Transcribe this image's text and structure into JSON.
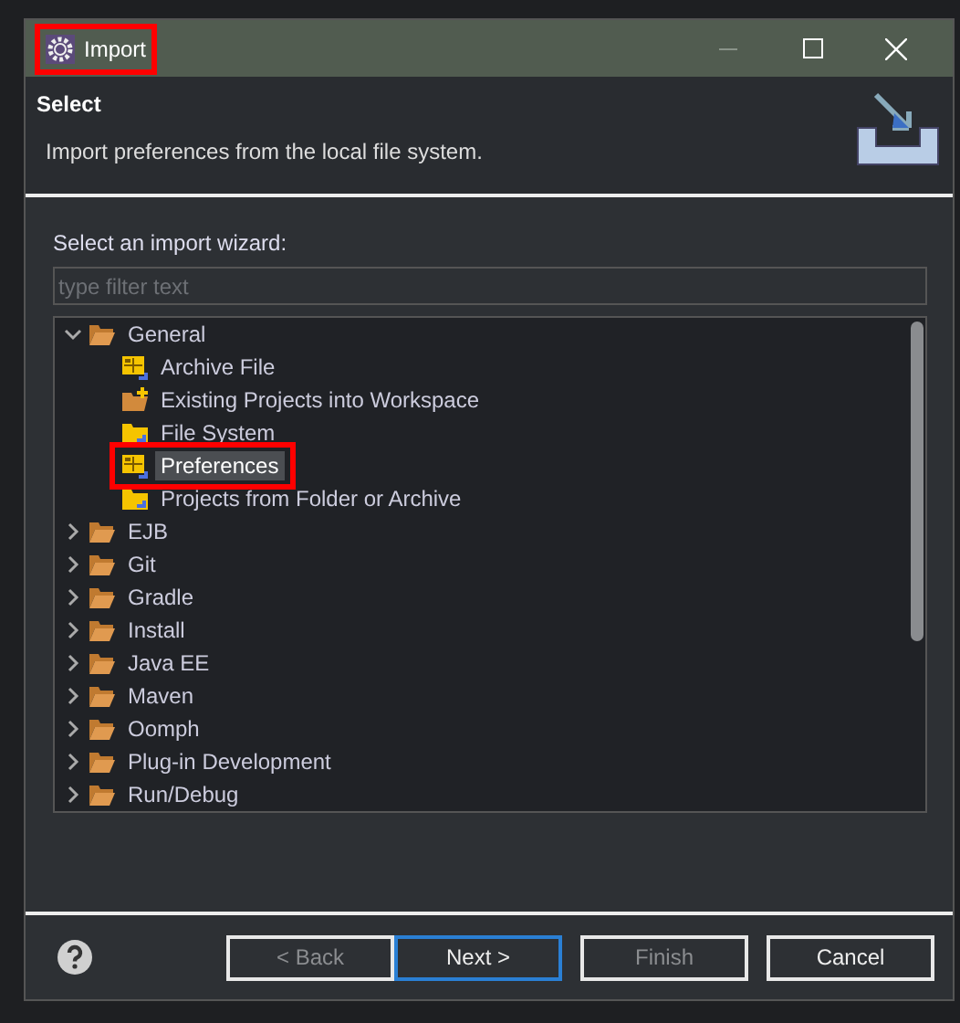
{
  "window": {
    "title": "Import",
    "highlighted": true
  },
  "header": {
    "title": "Select",
    "description": "Import preferences from the local file system."
  },
  "wizard": {
    "label": "Select an import wizard:",
    "filter": {
      "placeholder": "type filter text"
    },
    "tree": [
      {
        "label": "General",
        "expanded": true,
        "selected": false,
        "highlighted": false,
        "children": [
          {
            "label": "Archive File",
            "kind": "wizard",
            "selected": false,
            "highlighted": false
          },
          {
            "label": "Existing Projects into Workspace",
            "kind": "project",
            "selected": false,
            "highlighted": false
          },
          {
            "label": "File System",
            "kind": "folder",
            "selected": false,
            "highlighted": false
          },
          {
            "label": "Preferences",
            "kind": "wizard",
            "selected": true,
            "highlighted": true
          },
          {
            "label": "Projects from Folder or Archive",
            "kind": "folder",
            "selected": false,
            "highlighted": false
          }
        ]
      },
      {
        "label": "EJB",
        "expanded": false,
        "selected": false,
        "highlighted": false
      },
      {
        "label": "Git",
        "expanded": false,
        "selected": false,
        "highlighted": false
      },
      {
        "label": "Gradle",
        "expanded": false,
        "selected": false,
        "highlighted": false
      },
      {
        "label": "Install",
        "expanded": false,
        "selected": false,
        "highlighted": false
      },
      {
        "label": "Java EE",
        "expanded": false,
        "selected": false,
        "highlighted": false
      },
      {
        "label": "Maven",
        "expanded": false,
        "selected": false,
        "highlighted": false
      },
      {
        "label": "Oomph",
        "expanded": false,
        "selected": false,
        "highlighted": false
      },
      {
        "label": "Plug-in Development",
        "expanded": false,
        "selected": false,
        "highlighted": false
      },
      {
        "label": "Run/Debug",
        "expanded": false,
        "selected": false,
        "highlighted": false
      }
    ]
  },
  "buttons": [
    {
      "label": "< Back",
      "disabled": true,
      "default": false
    },
    {
      "label": "Next >",
      "disabled": false,
      "default": true
    },
    {
      "label": "Finish",
      "disabled": true,
      "default": false
    },
    {
      "label": "Cancel",
      "disabled": false,
      "default": false
    }
  ]
}
